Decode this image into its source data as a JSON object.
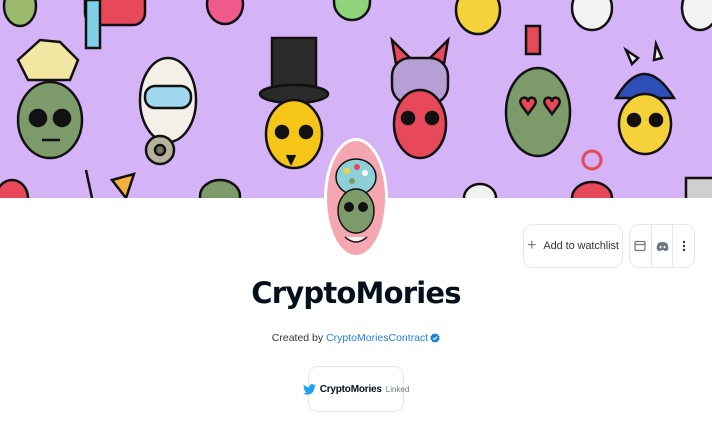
{
  "banner": {
    "background_color": "#d4b3f6",
    "alt": "CryptoMories collection banner"
  },
  "collection": {
    "name": "CryptoMories",
    "created_by_prefix": "Created by",
    "creator_name": "CryptoMoriesContract",
    "creator_verified": true
  },
  "actions": {
    "watchlist_label": "Add to watchlist",
    "watchlist_icon": "plus-icon",
    "icons": [
      "website-icon",
      "discord-icon",
      "more-options-icon"
    ]
  },
  "social": {
    "platform_icon": "twitter-icon",
    "handle": "CryptoMories",
    "status": "Linked"
  },
  "colors": {
    "link": "#2081e2",
    "twitter": "#1da1f2",
    "verified": "#2081e2",
    "border": "#e5e8eb"
  }
}
